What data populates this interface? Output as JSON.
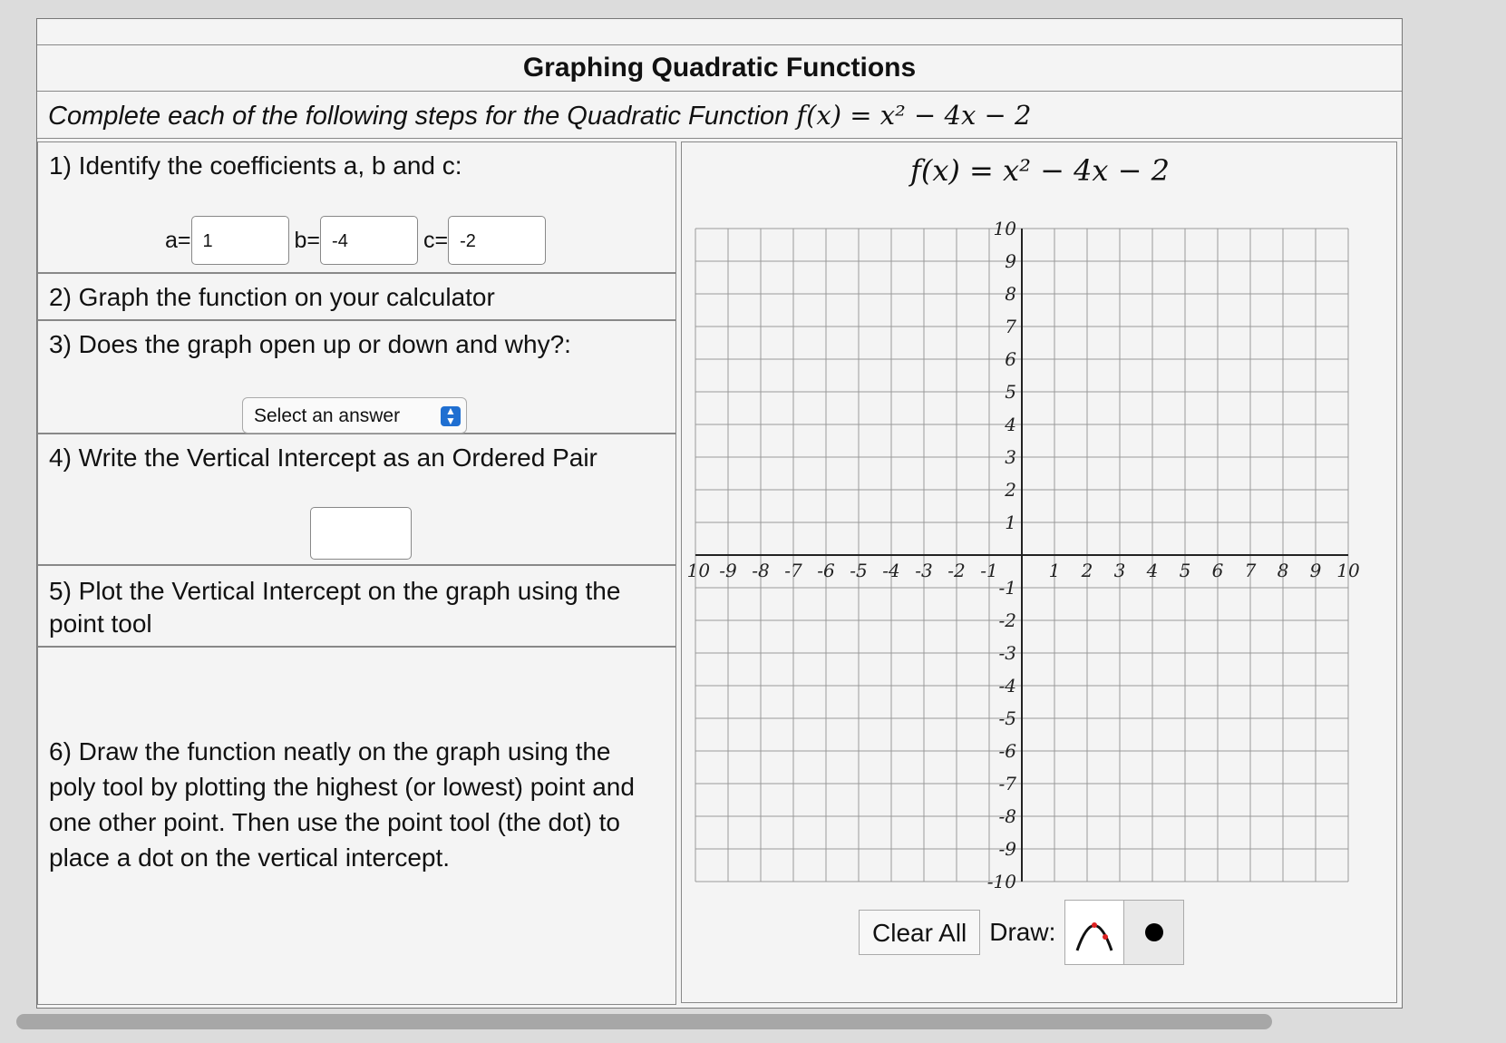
{
  "page": {
    "title": "Graphing Quadratic Functions",
    "instructions_prefix": "Complete each of the following steps for the Quadratic Function ",
    "function_expr": "f(x) = x² − 4x − 2"
  },
  "steps": {
    "s1_label": "1) Identify the coefficients a, b and c:",
    "a_label": "a=",
    "a_value": "1",
    "b_label": "b=",
    "b_value": "-4",
    "c_label": "c=",
    "c_value": "-2",
    "s2_label": "2) Graph the function on your calculator",
    "s3_label": "3) Does the graph open up or down and why?:",
    "s3_select": "Select an answer",
    "s4_label": "4) Write the Vertical Intercept as an Ordered Pair",
    "s4_value": "",
    "s5_label": "5) Plot the Vertical Intercept on the graph using the point tool",
    "s6_label": "6) Draw the function neatly on the graph using the poly tool by plotting the highest (or lowest) point and one other point. Then use the point tool (the dot) to place a dot on the vertical intercept."
  },
  "graph": {
    "title": "f(x) = x² − 4x − 2",
    "x_ticks": [
      "-10",
      "-9",
      "-8",
      "-7",
      "-6",
      "-5",
      "-4",
      "-3",
      "-2",
      "-1",
      "1",
      "2",
      "3",
      "4",
      "5",
      "6",
      "7",
      "8",
      "9",
      "10"
    ],
    "y_ticks": [
      "10",
      "9",
      "8",
      "7",
      "6",
      "5",
      "4",
      "3",
      "2",
      "1",
      "-1",
      "-2",
      "-3",
      "-4",
      "-5",
      "-6",
      "-7",
      "-8",
      "-9",
      "-10"
    ],
    "xlim": [
      -10,
      10
    ],
    "ylim": [
      -10,
      10
    ],
    "grid": true,
    "clear_label": "Clear All",
    "draw_label": "Draw:",
    "tools": [
      "parabola-tool-icon",
      "point-tool-icon"
    ]
  }
}
